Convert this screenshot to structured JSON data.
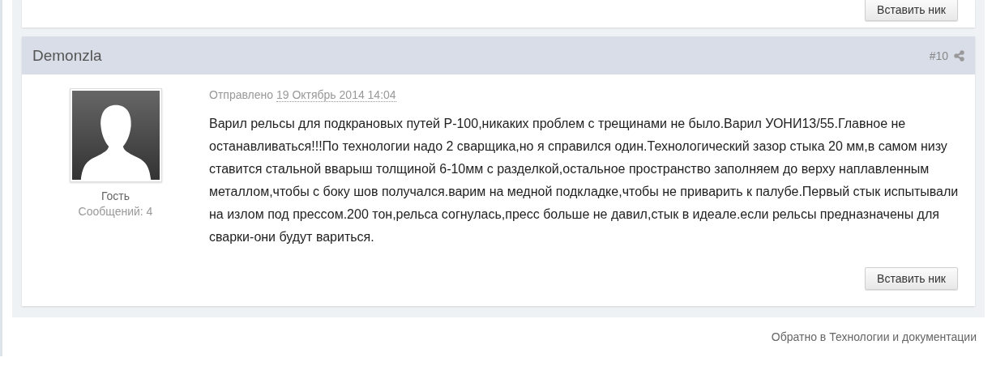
{
  "previous_post": {
    "button": "Вставить ник"
  },
  "post": {
    "author": "Demonzla",
    "number": "#10",
    "posted_label": "Отправлено",
    "posted_date": "19 Октябрь 2014 14:04",
    "user_group": "Гость",
    "post_count": "Сообщений: 4",
    "body": "Варил рельсы для подкрановых путей Р-100,никаких проблем с трещинами не было.Варил УОНИ13/55.Главное не останавливаться!!!По технологии надо 2 сварщика,но я справился один.Технологический зазор стыка 20 мм,в самом низу ставится стальной вварыш толщиной 6-10мм с разделкой,остальное пространство заполняем до верху наплавленным металлом,чтобы с боку шов получался.варим на медной подкладке,чтобы не приварить к палубе.Первый стык испытывали на излом под прессом.200 тон,рельса согнулась,пресс больше не давил,стык в идеале.если рельсы предназначены для сварки-они будут вариться.",
    "button": "Вставить ник"
  },
  "back_link": "Обратно в Технологии и документации"
}
